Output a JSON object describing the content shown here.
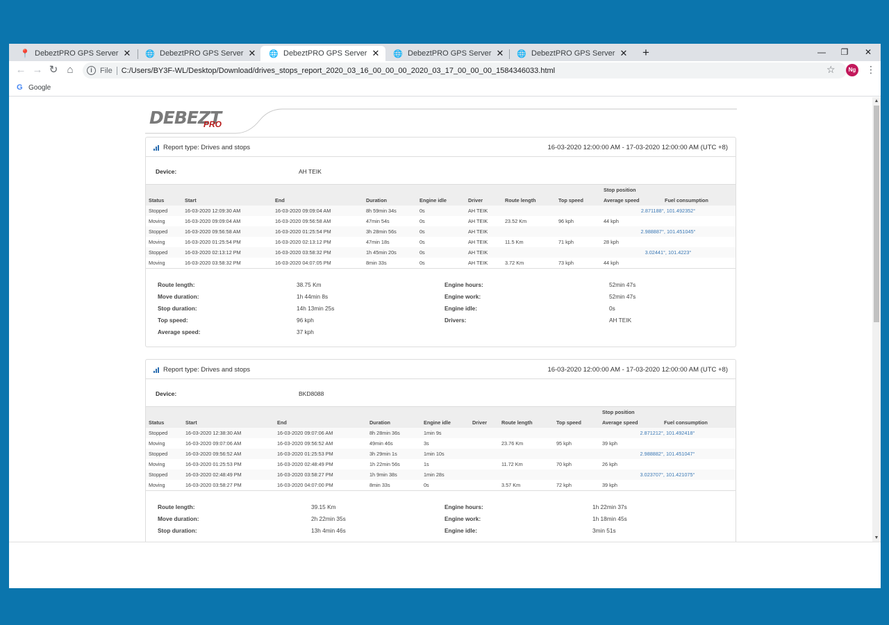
{
  "browser": {
    "tabs": [
      {
        "title": "DebeztPRO GPS Server",
        "icon": "map-pin-icon",
        "active": false
      },
      {
        "title": "DebeztPRO GPS Server",
        "icon": "globe-icon",
        "active": false
      },
      {
        "title": "DebeztPRO GPS Server",
        "icon": "globe-icon",
        "active": true
      },
      {
        "title": "DebeztPRO GPS Server",
        "icon": "globe-icon",
        "active": false
      },
      {
        "title": "DebeztPRO GPS Server",
        "icon": "globe-icon",
        "active": false
      }
    ],
    "new_tab_glyph": "+",
    "window_controls": {
      "minimize": "—",
      "restore": "❐",
      "close": "✕"
    },
    "address_scheme_label": "File",
    "url": "C:/Users/BY3F-WL/Desktop/Download/drives_stops_report_2020_03_16_00_00_00_2020_03_17_00_00_00_1584346033.html",
    "profile_initials": "Ng",
    "bookmark": "Google"
  },
  "logo": {
    "brand": "DEBEZT",
    "sub": "PRO"
  },
  "reports": [
    {
      "type_label": "Report type: Drives and stops",
      "range": "16-03-2020 12:00:00 AM - 17-03-2020 12:00:00 AM (UTC +8)",
      "device_label": "Device:",
      "device": "AH TEIK",
      "headers": {
        "group": "Stop position",
        "cols": [
          "Status",
          "Start",
          "End",
          "Duration",
          "Engine idle",
          "Driver",
          "Route length",
          "Top speed",
          "Average speed",
          "Fuel consumption"
        ]
      },
      "rows": [
        {
          "status": "Stopped",
          "start": "16-03-2020 12:09:30 AM",
          "end": "16-03-2020 09:09:04 AM",
          "duration": "8h 59min 34s",
          "idle": "0s",
          "driver": "AH TEIK",
          "route": "",
          "top": "",
          "avg": "",
          "pos": "2.871188°, 101.492352°"
        },
        {
          "status": "Moving",
          "start": "16-03-2020 09:09:04 AM",
          "end": "16-03-2020 09:56:58 AM",
          "duration": "47min 54s",
          "idle": "0s",
          "driver": "AH TEIK",
          "route": "23.52 Km",
          "top": "96 kph",
          "avg": "44 kph",
          "pos": ""
        },
        {
          "status": "Stopped",
          "start": "16-03-2020 09:56:58 AM",
          "end": "16-03-2020 01:25:54 PM",
          "duration": "3h 28min 56s",
          "idle": "0s",
          "driver": "AH TEIK",
          "route": "",
          "top": "",
          "avg": "",
          "pos": "2.988887°, 101.451045°"
        },
        {
          "status": "Moving",
          "start": "16-03-2020 01:25:54 PM",
          "end": "16-03-2020 02:13:12 PM",
          "duration": "47min 18s",
          "idle": "0s",
          "driver": "AH TEIK",
          "route": "11.5 Km",
          "top": "71 kph",
          "avg": "28 kph",
          "pos": ""
        },
        {
          "status": "Stopped",
          "start": "16-03-2020 02:13:12 PM",
          "end": "16-03-2020 03:58:32 PM",
          "duration": "1h 45min 20s",
          "idle": "0s",
          "driver": "AH TEIK",
          "route": "",
          "top": "",
          "avg": "",
          "pos": "3.02441°, 101.4223°"
        },
        {
          "status": "Moving",
          "start": "16-03-2020 03:58:32 PM",
          "end": "16-03-2020 04:07:05 PM",
          "duration": "8min 33s",
          "idle": "0s",
          "driver": "AH TEIK",
          "route": "3.72 Km",
          "top": "73 kph",
          "avg": "44 kph",
          "pos": ""
        }
      ],
      "summary_left": [
        {
          "label": "Route length:",
          "value": "38.75 Km"
        },
        {
          "label": "Move duration:",
          "value": "1h 44min 8s"
        },
        {
          "label": "Stop duration:",
          "value": "14h 13min 25s"
        },
        {
          "label": "Top speed:",
          "value": "96 kph"
        },
        {
          "label": "Average speed:",
          "value": "37 kph"
        }
      ],
      "summary_right": [
        {
          "label": "Engine hours:",
          "value": "52min 47s"
        },
        {
          "label": "Engine work:",
          "value": "52min 47s"
        },
        {
          "label": "Engine idle:",
          "value": "0s"
        },
        {
          "label": "Drivers:",
          "value": "AH TEIK"
        }
      ]
    },
    {
      "type_label": "Report type: Drives and stops",
      "range": "16-03-2020 12:00:00 AM - 17-03-2020 12:00:00 AM (UTC +8)",
      "device_label": "Device:",
      "device": "BKD8088",
      "headers": {
        "group": "Stop position",
        "cols": [
          "Status",
          "Start",
          "End",
          "Duration",
          "Engine idle",
          "Driver",
          "Route length",
          "Top speed",
          "Average speed",
          "Fuel consumption"
        ]
      },
      "rows": [
        {
          "status": "Stopped",
          "start": "16-03-2020 12:38:30 AM",
          "end": "16-03-2020 09:07:06 AM",
          "duration": "8h 28min 36s",
          "idle": "1min 9s",
          "driver": "",
          "route": "",
          "top": "",
          "avg": "",
          "pos": "2.871212°, 101.492418°"
        },
        {
          "status": "Moving",
          "start": "16-03-2020 09:07:06 AM",
          "end": "16-03-2020 09:56:52 AM",
          "duration": "49min 46s",
          "idle": "3s",
          "driver": "",
          "route": "23.76 Km",
          "top": "95 kph",
          "avg": "39 kph",
          "pos": ""
        },
        {
          "status": "Stopped",
          "start": "16-03-2020 09:56:52 AM",
          "end": "16-03-2020 01:25:53 PM",
          "duration": "3h 29min 1s",
          "idle": "1min 10s",
          "driver": "",
          "route": "",
          "top": "",
          "avg": "",
          "pos": "2.988882°, 101.451047°"
        },
        {
          "status": "Moving",
          "start": "16-03-2020 01:25:53 PM",
          "end": "16-03-2020 02:48:49 PM",
          "duration": "1h 22min 56s",
          "idle": "1s",
          "driver": "",
          "route": "11.72 Km",
          "top": "70 kph",
          "avg": "26 kph",
          "pos": ""
        },
        {
          "status": "Stopped",
          "start": "16-03-2020 02:48:49 PM",
          "end": "16-03-2020 03:58:27 PM",
          "duration": "1h 9min 38s",
          "idle": "1min 28s",
          "driver": "",
          "route": "",
          "top": "",
          "avg": "",
          "pos": "3.023707°, 101.421075°"
        },
        {
          "status": "Moving",
          "start": "16-03-2020 03:58:27 PM",
          "end": "16-03-2020 04:07:00 PM",
          "duration": "8min 33s",
          "idle": "0s",
          "driver": "",
          "route": "3.57 Km",
          "top": "72 kph",
          "avg": "39 kph",
          "pos": ""
        }
      ],
      "summary_left": [
        {
          "label": "Route length:",
          "value": "39.15 Km"
        },
        {
          "label": "Move duration:",
          "value": "2h 22min 35s"
        },
        {
          "label": "Stop duration:",
          "value": "13h 4min 46s"
        }
      ],
      "summary_right": [
        {
          "label": "Engine hours:",
          "value": "1h 22min 37s"
        },
        {
          "label": "Engine work:",
          "value": "1h 18min 45s"
        },
        {
          "label": "Engine idle:",
          "value": "3min 51s"
        }
      ]
    }
  ]
}
